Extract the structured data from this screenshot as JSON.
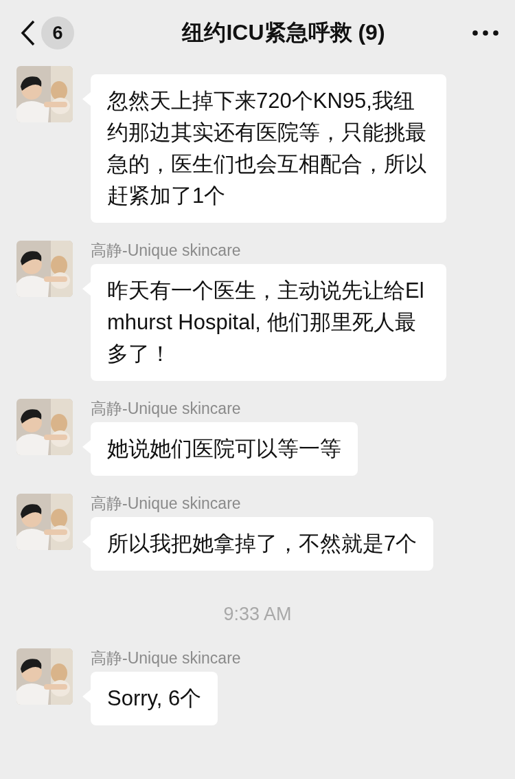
{
  "header": {
    "back_badge": "6",
    "title": "纽约ICU紧急呼救 (9)"
  },
  "messages": [
    {
      "kind": "message",
      "text": "忽然天上掉下来720个KN95,我纽约那边其实还有医院等，只能挑最急的，医生们也会互相配合，所以赶紧加了1个"
    },
    {
      "kind": "message",
      "sender": "高静-Unique skincare",
      "text": "昨天有一个医生，主动说先让给Elmhurst Hospital, 他们那里死人最多了！"
    },
    {
      "kind": "message",
      "sender": "高静-Unique skincare",
      "text": "她说她们医院可以等一等"
    },
    {
      "kind": "message",
      "sender": "高静-Unique skincare",
      "text": "所以我把她拿掉了，不然就是7个"
    },
    {
      "kind": "time",
      "text": "9:33 AM"
    },
    {
      "kind": "message",
      "sender": "高静-Unique skincare",
      "text": "Sorry, 6个"
    }
  ]
}
